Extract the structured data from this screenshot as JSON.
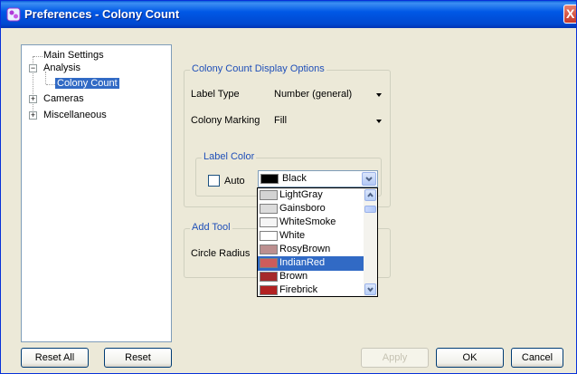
{
  "window": {
    "title": "Preferences - Colony Count",
    "close_glyph": "X"
  },
  "tree": {
    "items": [
      {
        "label": "Main Settings",
        "expander": ""
      },
      {
        "label": "Analysis",
        "expander": "−"
      },
      {
        "label": "Colony Count",
        "expander": "",
        "selected": true
      },
      {
        "label": "Cameras",
        "expander": "+"
      },
      {
        "label": "Miscellaneous",
        "expander": "+"
      }
    ]
  },
  "display_options": {
    "legend": "Colony Count Display Options",
    "label_type_label": "Label Type",
    "label_type_value": "Number (general)",
    "colony_marking_label": "Colony Marking",
    "colony_marking_value": "Fill"
  },
  "label_color": {
    "legend": "Label Color",
    "auto_label": "Auto",
    "auto_checked": false,
    "selected_color_name": "Black",
    "selected_color_hex": "#000000"
  },
  "color_dropdown": {
    "items": [
      {
        "name": "LightGray",
        "hex": "#d3d3d3"
      },
      {
        "name": "Gainsboro",
        "hex": "#dcdcdc"
      },
      {
        "name": "WhiteSmoke",
        "hex": "#f5f5f5"
      },
      {
        "name": "White",
        "hex": "#ffffff"
      },
      {
        "name": "RosyBrown",
        "hex": "#bc8f8f"
      },
      {
        "name": "IndianRed",
        "hex": "#cd5c5c",
        "selected": true
      },
      {
        "name": "Brown",
        "hex": "#a52a2a"
      },
      {
        "name": "Firebrick",
        "hex": "#b22222"
      }
    ]
  },
  "add_tool": {
    "legend": "Add Tool",
    "circle_radius_label": "Circle Radius"
  },
  "buttons": {
    "reset_all": "Reset All",
    "reset": "Reset",
    "apply": "Apply",
    "ok": "OK",
    "cancel": "Cancel"
  },
  "colors": {
    "titlebar_accent": "#0054e3",
    "selection": "#316ac5",
    "group_legend": "#1f4fb8"
  }
}
